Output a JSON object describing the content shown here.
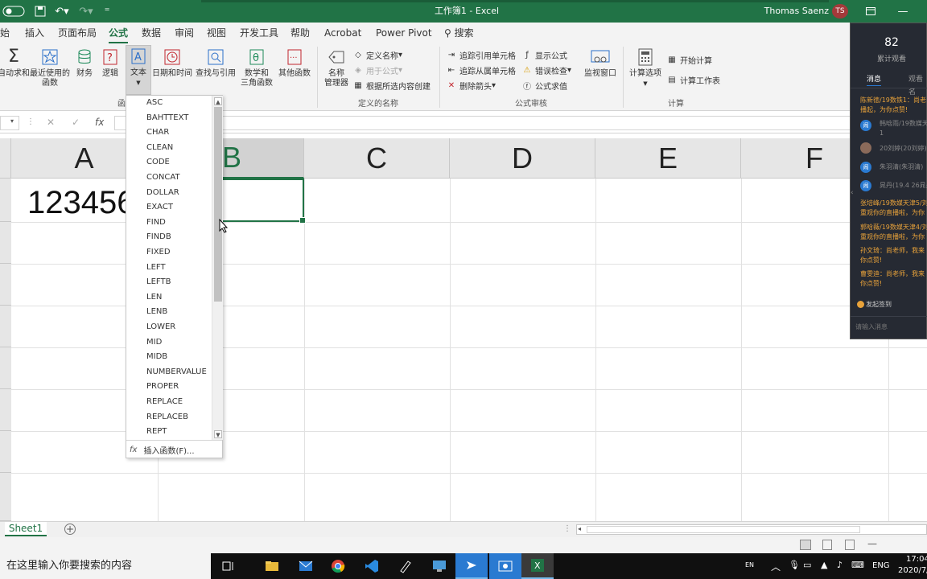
{
  "window": {
    "title": "工作簿1 - Excel",
    "user": "Thomas Saenz",
    "user_initials": "TS"
  },
  "tabs": [
    "始",
    "插入",
    "页面布局",
    "公式",
    "数据",
    "审阅",
    "视图",
    "开发工具",
    "帮助",
    "Acrobat",
    "Power Pivot"
  ],
  "search_tab": "搜索",
  "ribbon": {
    "library": {
      "autosum": "自动求和",
      "recent": "最近使用的\n函数",
      "finance": "财务",
      "logic": "逻辑",
      "text": "文本",
      "datetime": "日期和时间",
      "lookup": "查找与引用",
      "math": "数学和\n三角函数",
      "other": "其他函数",
      "group_label": "函"
    },
    "names": {
      "manager": "名称\n管理器",
      "define": "定义名称",
      "use_in_formula": "用于公式",
      "create_from_selection": "根据所选内容创建",
      "group_label": "定义的名称"
    },
    "audit": {
      "trace_precedents": "追踪引用单元格",
      "trace_dependents": "追踪从属单元格",
      "remove_arrows": "删除箭头",
      "show_formulas": "显示公式",
      "error_check": "错误检查",
      "evaluate": "公式求值",
      "watch": "监视窗口",
      "group_label": "公式审核"
    },
    "calc": {
      "options": "计算选项",
      "calc_now": "开始计算",
      "calc_sheet": "计算工作表",
      "group_label": "计算"
    }
  },
  "formula_bar": {
    "cancel": "✕",
    "enter": "✓",
    "fx": "fx"
  },
  "grid": {
    "columns": [
      "A",
      "B",
      "C",
      "D",
      "E",
      "F"
    ],
    "selected_column": "B",
    "cell_a1": "123456"
  },
  "dropdown": {
    "items": [
      "ASC",
      "BAHTTEXT",
      "CHAR",
      "CLEAN",
      "CODE",
      "CONCAT",
      "DOLLAR",
      "EXACT",
      "FIND",
      "FINDB",
      "FIXED",
      "LEFT",
      "LEFTB",
      "LEN",
      "LENB",
      "LOWER",
      "MID",
      "MIDB",
      "NUMBERVALUE",
      "PROPER",
      "REPLACE",
      "REPLACEB",
      "REPT"
    ],
    "insert_function": "插入函数(F)..."
  },
  "sheets": {
    "active": "Sheet1",
    "add": "+"
  },
  "panel": {
    "viewer_count": "82",
    "viewer_label": "累计观看",
    "tab_messages": "消息",
    "tab_viewers": "观看名",
    "messages": [
      {
        "text": "陈新徳/19数铁1：尚老",
        "color": "#e8a23a"
      },
      {
        "text": "播起，为你点赞!",
        "color": "#e8a23a"
      },
      {
        "text": "韩晗雨/19数媒天",
        "color": "#888888"
      },
      {
        "text": "1",
        "color": "#888888"
      },
      {
        "text": "20刘婷(20刘婷)",
        "color": "#888888"
      },
      {
        "text": "朱羽清(朱羽清)",
        "color": "#888888"
      },
      {
        "text": "晁丹(19.4 26晁丹",
        "color": "#888888"
      },
      {
        "text": "张培峰/19数媒天津5/刘",
        "color": "#e8a23a"
      },
      {
        "text": "重观你的直播啦，为你",
        "color": "#e8a23a"
      },
      {
        "text": "郭晗薇/19数媒天津4/刘",
        "color": "#e8a23a"
      },
      {
        "text": "重观你的直播啦，为你",
        "color": "#e8a23a"
      },
      {
        "text": "孙文琦：尚老师，我来",
        "color": "#e8a23a"
      },
      {
        "text": "你点赞!",
        "color": "#e8a23a"
      },
      {
        "text": "曹雯迪：尚老师，我来",
        "color": "#e8a23a"
      },
      {
        "text": "你点赞!",
        "color": "#e8a23a"
      }
    ],
    "signin": "发起签到",
    "input_placeholder": "请输入消息"
  },
  "taskbar": {
    "search_placeholder": "在这里输入你要搜索的内容",
    "lang": "ENG",
    "ime": "EN",
    "time": "17:04",
    "date": "2020/7/"
  },
  "colors": {
    "excel_green": "#217346",
    "panel_bg": "#262a33"
  }
}
